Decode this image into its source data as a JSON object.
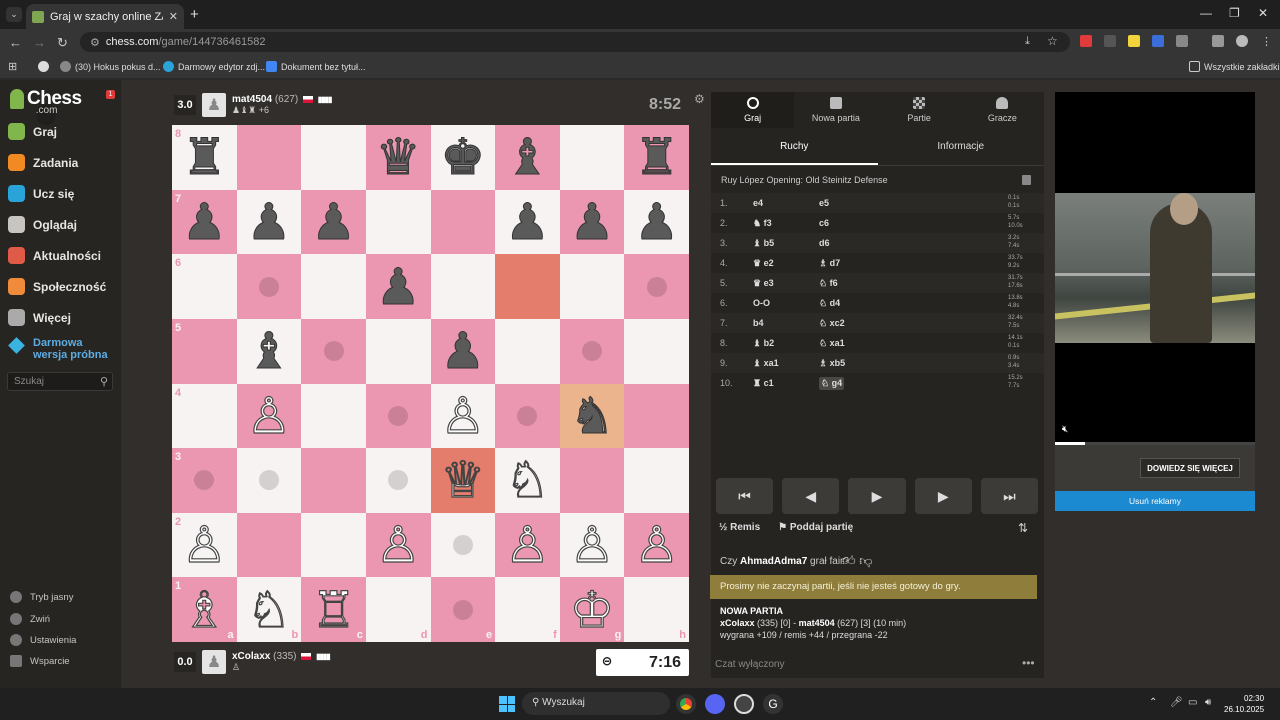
{
  "browser": {
    "tab_title": "Graj w szachy online ZA DARMO",
    "url_host": "chess.com",
    "url_path": "/game/144736461582",
    "bookmarks": [
      "(30) Hokus pokus d...",
      "Darmowy edytor zdj...",
      "Dokument bez tytuł..."
    ],
    "all_bookmarks": "Wszystkie zakładki"
  },
  "sidebar": {
    "logo": "Chess",
    "logo_suffix": ".com",
    "notif": "1",
    "nav": [
      {
        "label": "Graj",
        "icon": "play-hand-icon",
        "color": "#81b64c"
      },
      {
        "label": "Zadania",
        "icon": "puzzle-icon",
        "color": "#f28a24"
      },
      {
        "label": "Ucz się",
        "icon": "learn-icon",
        "color": "#2aa3d8"
      },
      {
        "label": "Oglądaj",
        "icon": "binoculars-icon",
        "color": "#c8c5c0"
      },
      {
        "label": "Aktualności",
        "icon": "news-icon",
        "color": "#e05a48"
      },
      {
        "label": "Społeczność",
        "icon": "community-icon",
        "color": "#ef8b3b"
      },
      {
        "label": "Więcej",
        "icon": "more-icon",
        "color": "#aaaaaa"
      }
    ],
    "trial": "Darmowa wersja próbna",
    "search_placeholder": "Szukaj",
    "bottom": [
      "Tryb jasny",
      "Zwiń",
      "Ustawienia",
      "Wsparcie"
    ]
  },
  "top_player": {
    "score": "3.0",
    "name": "mat4504",
    "rating": "(627)",
    "advantage": "+6",
    "clock": "8:52"
  },
  "bottom_player": {
    "score": "0.0",
    "name": "xColaxx",
    "rating": "(335)",
    "clock": "7:16"
  },
  "board": {
    "ranks": [
      "8",
      "7",
      "6",
      "5",
      "4",
      "3",
      "2",
      "1"
    ],
    "files": [
      "a",
      "b",
      "c",
      "d",
      "e",
      "f",
      "g",
      "h"
    ],
    "position": [
      [
        "♜",
        "",
        "",
        "♛",
        "♚",
        "♝",
        "",
        "♜"
      ],
      [
        "♟",
        "♟",
        "♟",
        "",
        "",
        "♟",
        "♟",
        "♟"
      ],
      [
        "",
        "",
        "",
        "♟",
        "",
        "",
        "",
        ""
      ],
      [
        "",
        "♝",
        "",
        "",
        "♟",
        "",
        "",
        ""
      ],
      [
        "",
        "P",
        "",
        "",
        "P",
        "",
        "♞",
        ""
      ],
      [
        "",
        "",
        "",
        "",
        "Q",
        "N",
        "",
        ""
      ],
      [
        "P",
        "",
        "",
        "P",
        "",
        "P",
        "P",
        "P"
      ],
      [
        "B",
        "N",
        "R",
        "",
        "",
        "",
        "K",
        ""
      ]
    ]
  },
  "panel": {
    "tabs": [
      "Graj",
      "Nowa partia",
      "Partie",
      "Gracze"
    ],
    "subtabs": [
      "Ruchy",
      "Informacje"
    ],
    "opening": "Ruy López Opening: Old Steinitz Defense",
    "moves": [
      {
        "n": "1.",
        "w": "e4",
        "b": "e5",
        "tw": "0.1s",
        "tb": "0.1s"
      },
      {
        "n": "2.",
        "w": "♞ f3",
        "b": "c6",
        "tw": "5.7s",
        "tb": "10.0s"
      },
      {
        "n": "3.",
        "w": "♝ b5",
        "b": "d6",
        "tw": "3.2s",
        "tb": "7.4s"
      },
      {
        "n": "4.",
        "w": "♛ e2",
        "b": "♗ d7",
        "tw": "33.7s",
        "tb": "9.2s"
      },
      {
        "n": "5.",
        "w": "♛ e3",
        "b": "♘ f6",
        "tw": "31.7s",
        "tb": "17.6s"
      },
      {
        "n": "6.",
        "w": "O-O",
        "b": "♘ d4",
        "tw": "13.8s",
        "tb": "4.8s"
      },
      {
        "n": "7.",
        "w": "b4",
        "b": "♘ xc2",
        "tw": "32.4s",
        "tb": "7.5s"
      },
      {
        "n": "8.",
        "w": "♝ b2",
        "b": "♘ xa1",
        "tw": "14.1s",
        "tb": "0.1s"
      },
      {
        "n": "9.",
        "w": "♝ xa1",
        "b": "♗ xb5",
        "tw": "0.9s",
        "tb": "3.4s"
      },
      {
        "n": "10.",
        "w": "♜ c1",
        "b": "♘ g4",
        "tw": "15.2s",
        "tb": "7.7s"
      }
    ],
    "controls": [
      "⏮",
      "◀",
      "▶",
      "▶",
      "⏭"
    ],
    "draw": "Remis",
    "resign": "Poddaj partię",
    "fair_q_pre": "Czy",
    "fair_user": "AhmadAdma7",
    "fair_q_post": "grał fair?",
    "warning": "Prosimy nie zaczynaj partii, jeśli nie jesteś gotowy do gry.",
    "newgame_title": "NOWA PARTIA",
    "newgame_line1_a": "xColaxx",
    "newgame_line1_b": "(335) [0] -",
    "newgame_line1_c": "mat4504",
    "newgame_line1_d": "(627) [3] (10 min)",
    "newgame_line2": "wygrana +109 / remis +44 / przegrana -22",
    "chat_placeholder": "Czat wyłączony"
  },
  "ad": {
    "cta": "DOWIEDZ SIĘ WIĘCEJ",
    "remove": "Usuń reklamy"
  },
  "taskbar": {
    "search": "Wyszukaj",
    "time": "02:30",
    "date": "26.10.2025"
  }
}
